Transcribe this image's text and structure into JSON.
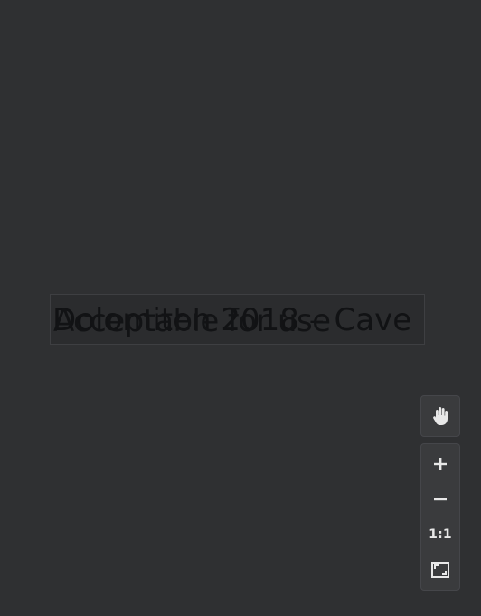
{
  "canvas": {
    "layer_texts": [
      "Dolomiten 2018 – Cave",
      "Acceptable for use"
    ]
  },
  "controls": {
    "pan_icon": "hand-icon",
    "zoom_in_icon": "plus-icon",
    "zoom_out_icon": "minus-icon",
    "actual_size_label": "1:1",
    "fit_icon": "fit-to-screen-icon"
  },
  "colors": {
    "background": "#2f3032",
    "panel": "#3a3b3d",
    "icon": "#e8e8e8",
    "text_overlay": "#111214"
  }
}
